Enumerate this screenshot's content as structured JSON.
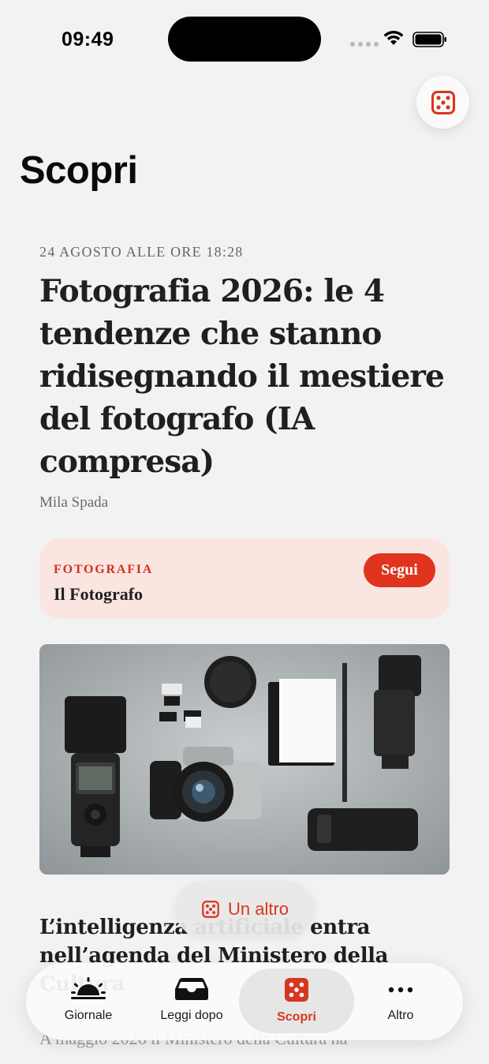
{
  "status_bar": {
    "time": "09:49"
  },
  "page": {
    "title": "Scopri"
  },
  "article": {
    "date": "24 AGOSTO ALLE ORE 18:28",
    "title": "Fotografia 2026: le 4 tendenze che stanno ridisegnando il mestiere del fotografo (IA compresa)",
    "author": "Mila Spada"
  },
  "topic": {
    "category": "FOTOGRAFIA",
    "name": "Il Fotografo",
    "follow_label": "Segui"
  },
  "next_article": {
    "title": "L’intelligenza artificiale entra nell’agenda del Ministero della Cultura",
    "excerpt": "A maggio 2026 il Ministero della Cultura ha"
  },
  "another_button": {
    "label": "Un altro",
    "icon": "dice-icon"
  },
  "tabs": [
    {
      "label": "Giornale",
      "icon": "sunrise-icon",
      "active": false
    },
    {
      "label": "Leggi dopo",
      "icon": "inbox-tray-icon",
      "active": false
    },
    {
      "label": "Scopri",
      "icon": "dice-icon",
      "active": true
    },
    {
      "label": "Altro",
      "icon": "ellipsis-icon",
      "active": false
    }
  ],
  "colors": {
    "accent": "#e0341e",
    "topic_bg": "#fbe5e1",
    "background": "#f2f2f2"
  }
}
